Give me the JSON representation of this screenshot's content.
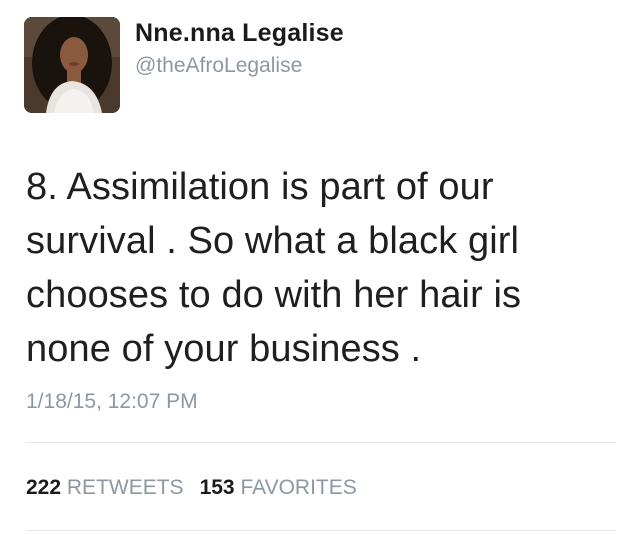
{
  "user": {
    "display_name": "Nne.nna Legalise",
    "handle": "@theAfroLegalise"
  },
  "tweet": {
    "text": "8. Assimilation is part of our\nsurvival . So what a black girl\nchooses to do with her hair is\nnone of your business .",
    "timestamp": "1/18/15, 12:07 PM"
  },
  "stats": {
    "retweets_count": "222",
    "retweets_label": "RETWEETS",
    "favorites_count": "153",
    "favorites_label": "FAVORITES"
  },
  "colors": {
    "name": "#1b1b1b",
    "secondary": "#8b98a3",
    "divider": "#e2e6e9"
  }
}
